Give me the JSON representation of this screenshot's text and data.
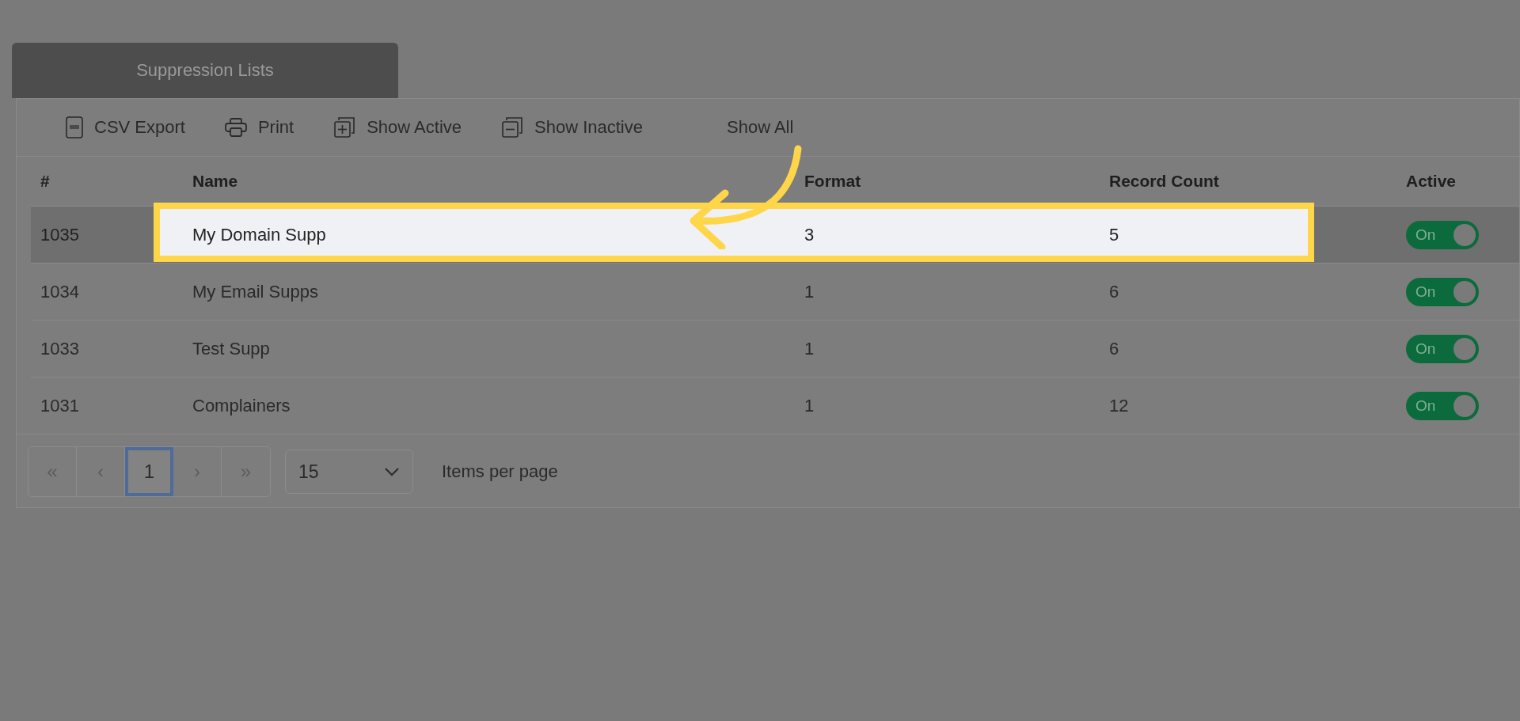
{
  "tabs": [
    {
      "label": "Suppression Lists",
      "selected": true
    }
  ],
  "toolbar": [
    {
      "kind": "csv",
      "label": "CSV Export"
    },
    {
      "kind": "print",
      "label": "Print"
    },
    {
      "kind": "plus",
      "label": "Show Active"
    },
    {
      "kind": "minus",
      "label": "Show Inactive"
    },
    {
      "kind": "none",
      "label": "Show All"
    }
  ],
  "table": {
    "columns": [
      "#",
      "Name",
      "Format",
      "Record Count",
      "Active"
    ],
    "rows": [
      {
        "id": "1035",
        "name": "My Domain Supp",
        "format": "3",
        "record_count": "5",
        "active": true,
        "toggle_label": "On",
        "selected": true
      },
      {
        "id": "1034",
        "name": "My Email Supps",
        "format": "1",
        "record_count": "6",
        "active": true,
        "toggle_label": "On",
        "selected": false
      },
      {
        "id": "1033",
        "name": "Test Supp",
        "format": "1",
        "record_count": "6",
        "active": true,
        "toggle_label": "On",
        "selected": false
      },
      {
        "id": "1031",
        "name": "Complainers",
        "format": "1",
        "record_count": "12",
        "active": true,
        "toggle_label": "On",
        "selected": false
      }
    ]
  },
  "pager": {
    "first": "«",
    "prev": "‹",
    "pages": [
      {
        "label": "1",
        "selected": true
      }
    ],
    "next": "›",
    "last": "»",
    "page_size": "15",
    "page_size_label": "Items per page"
  }
}
